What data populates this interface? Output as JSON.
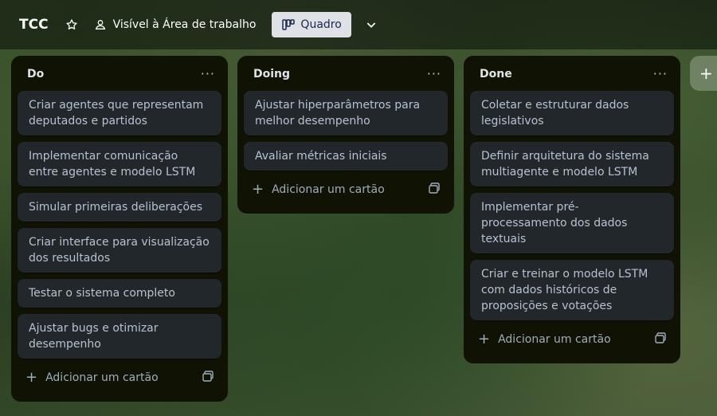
{
  "header": {
    "board_title": "TCC",
    "visibility_label": "Visível à Área de trabalho",
    "view_label": "Quadro"
  },
  "lists": [
    {
      "title": "Do",
      "cards": [
        "Criar agentes que representam deputados e partidos",
        "Implementar comunicação entre agentes e modelo LSTM",
        "Simular primeiras deliberações",
        "Criar interface para visualização dos resultados",
        "Testar o sistema completo",
        "Ajustar bugs e otimizar desempenho"
      ],
      "add_label": "Adicionar um cartão"
    },
    {
      "title": "Doing",
      "cards": [
        "Ajustar hiperparâmetros para melhor desempenho",
        "Avaliar métricas iniciais"
      ],
      "add_label": "Adicionar um cartão"
    },
    {
      "title": "Done",
      "cards": [
        "Coletar e estruturar dados legislativos",
        "Definir arquitetura do sistema multiagente e modelo LSTM",
        "Implementar pré-processamento dos dados textuais",
        "Criar e treinar o modelo LSTM com dados históricos de proposições e votações"
      ],
      "add_label": "Adicionar um cartão"
    }
  ],
  "icons": {
    "star": "star-icon",
    "visibility": "workspace-visibility-icon",
    "view": "board-view-icon",
    "chevron": "chevron-down-icon",
    "list_menu": "ellipsis-icon",
    "add": "plus-icon",
    "template": "card-template-icon"
  },
  "colors": {
    "list_bg": "#101204",
    "card_bg": "#22272b",
    "text": "#b6c2cf",
    "view_button_bg": "#dfe1e6"
  }
}
